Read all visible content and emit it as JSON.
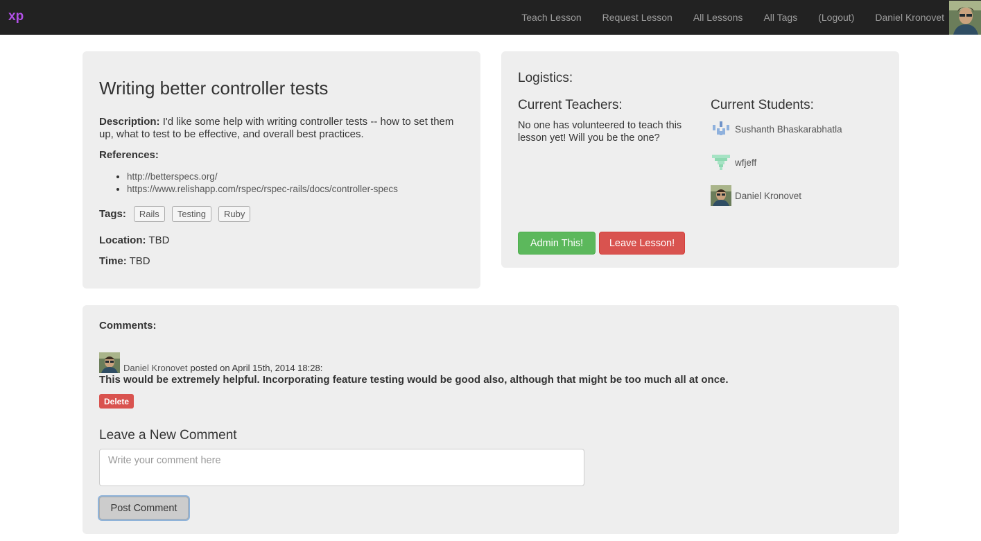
{
  "navbar": {
    "brand": "xp",
    "links": [
      "Teach Lesson",
      "Request Lesson",
      "All Lessons",
      "All Tags",
      "(Logout)",
      "Daniel Kronovet"
    ]
  },
  "lesson": {
    "title": "Writing better controller tests",
    "description_label": "Description:",
    "description": "I'd like some help with writing controller tests -- how to set them up, what to test to be effective, and overall best practices.",
    "references_label": "References:",
    "references": [
      "http://betterspecs.org/",
      "https://www.relishapp.com/rspec/rspec-rails/docs/controller-specs"
    ],
    "tags_label": "Tags:",
    "tags": [
      "Rails",
      "Testing",
      "Ruby"
    ],
    "location_label": "Location:",
    "location": "TBD",
    "time_label": "Time:",
    "time": "TBD"
  },
  "logistics": {
    "title": "Logistics:",
    "teachers_title": "Current Teachers:",
    "teachers_message": "No one has volunteered to teach this lesson yet! Will you be the one?",
    "students_title": "Current Students:",
    "students": [
      "Sushanth Bhaskarabhatla",
      "wfjeff",
      "Daniel Kronovet"
    ],
    "admin_button": "Admin This!",
    "leave_button": "Leave Lesson!"
  },
  "comments": {
    "label": "Comments:",
    "items": [
      {
        "author": "Daniel Kronovet",
        "posted": "posted on April 15th, 2014 18:28:",
        "body": "This would be extremely helpful. Incorporating feature testing would be good also, although that might be too much all at once.",
        "delete_label": "Delete"
      }
    ],
    "new_title": "Leave a New Comment",
    "placeholder": "Write your comment here",
    "post_button": "Post Comment"
  },
  "colors": {
    "navbar_bg": "#222222",
    "brand": "#b150e6",
    "panel_bg": "#eeeeee",
    "success": "#5cb85c",
    "danger": "#d9534f"
  },
  "icons": {
    "user_avatar": "user-photo-avatar",
    "student_1": "identicon-blue",
    "student_2": "identicon-green"
  }
}
